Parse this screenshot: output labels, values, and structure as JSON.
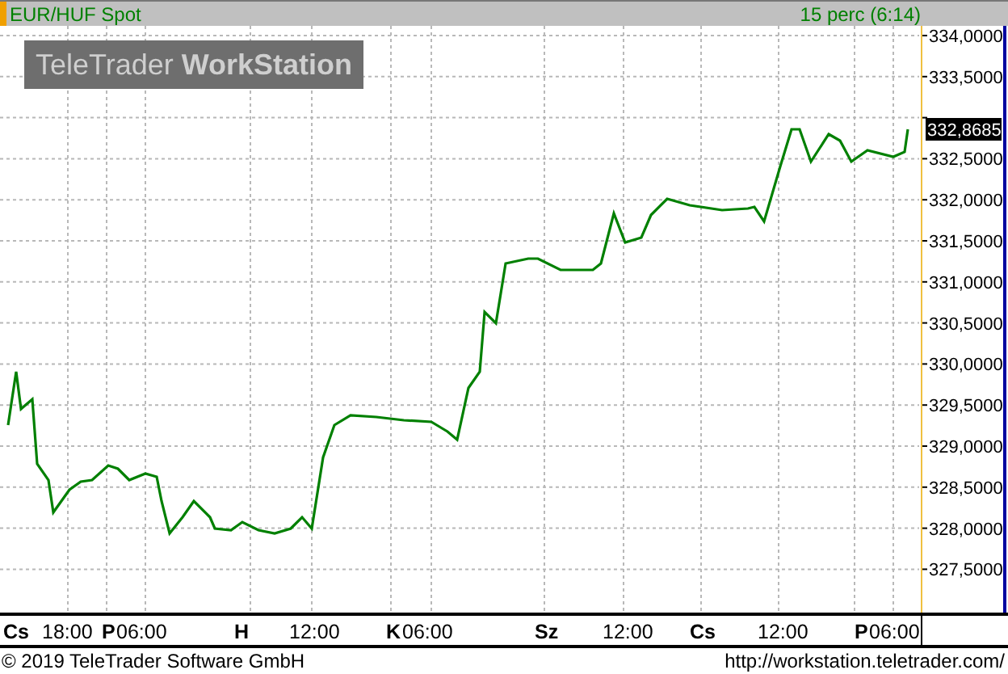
{
  "header": {
    "title": "EUR/HUF Spot",
    "interval": "15 perc (6:14)"
  },
  "logo": {
    "text": "TeleTrader **WorkStation**"
  },
  "price_axis": [
    "334,0000",
    "333,5000",
    "332,5000",
    "332,0000",
    "331,5000",
    "331,0000",
    "330,5000",
    "330,0000",
    "329,5000",
    "329,0000",
    "328,5000",
    "328,0000",
    "327,5000"
  ],
  "last_price": "332,8685",
  "time_axis": [
    {
      "label": "Cs",
      "kind": "day"
    },
    {
      "label": "18:00",
      "kind": "time"
    },
    {
      "label": "P",
      "kind": "day"
    },
    {
      "label": "06:00",
      "kind": "time"
    },
    {
      "label": "H",
      "kind": "day"
    },
    {
      "label": "12:00",
      "kind": "time"
    },
    {
      "label": "K",
      "kind": "day"
    },
    {
      "label": "06:00",
      "kind": "time"
    },
    {
      "label": "Sz",
      "kind": "day"
    },
    {
      "label": "12:00",
      "kind": "time"
    },
    {
      "label": "Cs",
      "kind": "day"
    },
    {
      "label": "12:00",
      "kind": "time"
    },
    {
      "label": "P",
      "kind": "day"
    },
    {
      "label": "06:00",
      "kind": "time"
    }
  ],
  "footer": {
    "copyright": "© 2019 TeleTrader Software GmbH",
    "url": "http://workstation.teletrader.com/"
  }
}
